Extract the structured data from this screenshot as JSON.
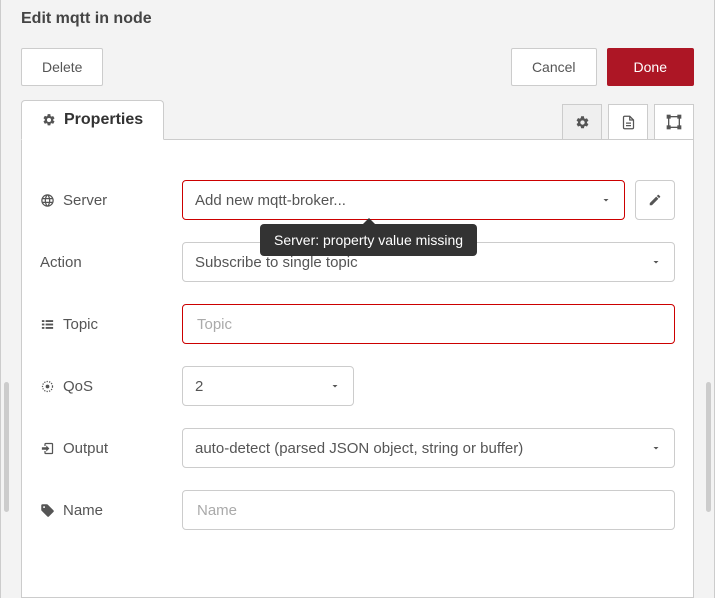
{
  "header": {
    "title": "Edit mqtt in node"
  },
  "buttons": {
    "delete": "Delete",
    "cancel": "Cancel",
    "done": "Done"
  },
  "tabs": {
    "properties": "Properties"
  },
  "tooltip": {
    "server_missing": "Server: property value missing"
  },
  "form": {
    "server": {
      "label": "Server",
      "value": "Add new mqtt-broker..."
    },
    "action": {
      "label": "Action",
      "value": "Subscribe to single topic"
    },
    "topic": {
      "label": "Topic",
      "placeholder": "Topic",
      "value": ""
    },
    "qos": {
      "label": "QoS",
      "value": "2"
    },
    "output": {
      "label": "Output",
      "value": "auto-detect (parsed JSON object, string or buffer)"
    },
    "name": {
      "label": "Name",
      "placeholder": "Name",
      "value": ""
    }
  }
}
